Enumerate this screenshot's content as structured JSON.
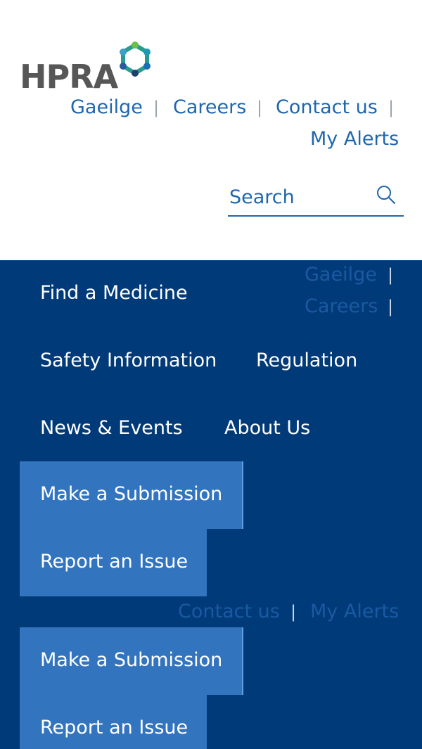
{
  "brand": {
    "name": "HPRA",
    "accent": "#1f67ad",
    "nav_bg": "#003a78",
    "cta_bg": "#3374be"
  },
  "utility_links": [
    "Gaeilge",
    "Careers",
    "Contact us",
    "My Alerts"
  ],
  "search": {
    "placeholder": "Search"
  },
  "nav": {
    "items": [
      "Find a Medicine",
      "Safety Information",
      "Regulation",
      "News & Events",
      "About Us"
    ],
    "ghost_links": [
      "Gaeilge",
      "Careers",
      "Contact us",
      "My Alerts"
    ],
    "cta_primary": "Make a Submission",
    "cta_secondary": "Report an Issue"
  }
}
